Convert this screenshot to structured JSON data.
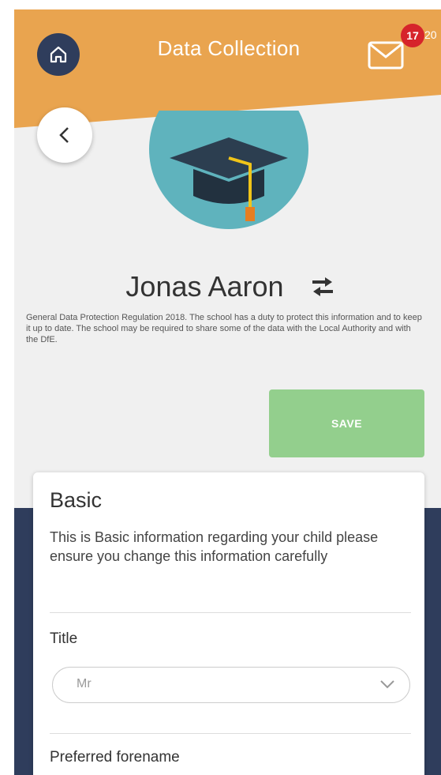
{
  "header": {
    "title": "Data Collection",
    "badge_count": "17",
    "badge_suffix": "20",
    "color": "#e9a44f"
  },
  "student": {
    "name": "Jonas Aaron"
  },
  "gdpr_notice": "General Data Protection Regulation 2018. The school has a duty to protect this information and to keep it up to date. The school may be required to share some of the data with the Local Authority and with the DfE.",
  "save_label": "SAVE",
  "card": {
    "title": "Basic",
    "description": "This is Basic information regarding your child please ensure you change this information carefully",
    "fields": [
      {
        "label": "Title",
        "value": "Mr"
      },
      {
        "label": "Preferred forename"
      }
    ]
  },
  "colors": {
    "navy": "#2f3d5c",
    "save": "#93cf8d",
    "avatar": "#5fb3bd",
    "badge": "#d6242b"
  },
  "icons": [
    "home-icon",
    "mail-icon",
    "back-chevron-icon",
    "graduation-cap-icon",
    "swap-icon",
    "chevron-down-icon"
  ]
}
